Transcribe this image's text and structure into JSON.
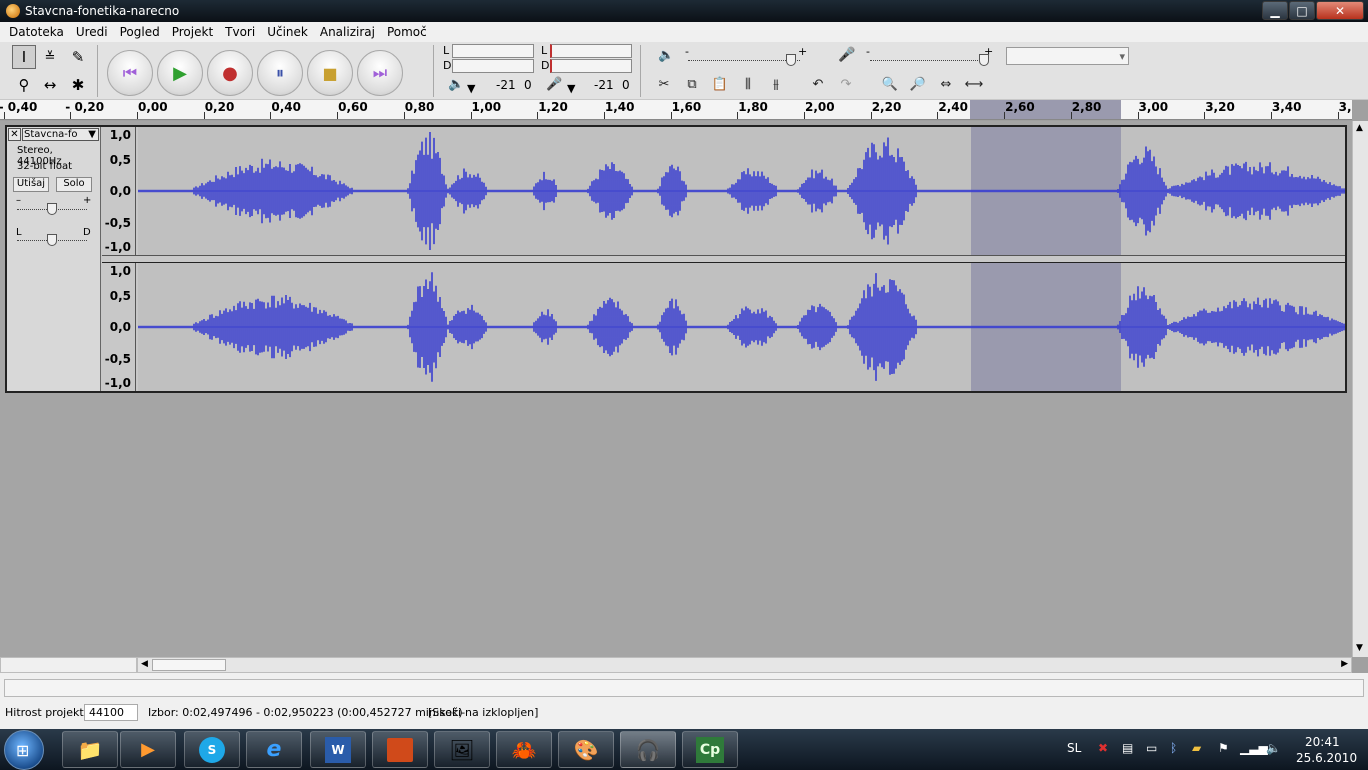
{
  "window": {
    "title": "Stavcna-fonetika-narecno",
    "minimize": "▁",
    "maximize": "□",
    "close": "✕"
  },
  "menu": [
    "Datoteka",
    "Uredi",
    "Pogled",
    "Projekt",
    "Tvori",
    "Učinek",
    "Analiziraj",
    "Pomoč"
  ],
  "tools": {
    "select": "I",
    "envelope": "≚",
    "draw": "✎",
    "zoom": "⚲",
    "timeshift": "↔",
    "multi": "✱"
  },
  "transport": {
    "skip_start": "⏮",
    "play": "▶",
    "record": "●",
    "pause": "⏸",
    "stop": "■",
    "skip_end": "⏭"
  },
  "meters": {
    "playback_left": "L",
    "playback_right": "D",
    "record_left": "L",
    "record_right": "D",
    "playback_db": "-21",
    "playback_zero": "0",
    "record_db": "-21",
    "record_zero": "0"
  },
  "mixer": {
    "speaker_icon": "speaker-icon",
    "mic_icon": "microphone-icon",
    "minus": "-",
    "plus": "+",
    "device_select": ""
  },
  "ruler": {
    "labels": [
      "- 0,40",
      "- 0,20",
      "0,00",
      "0,20",
      "0,40",
      "0,60",
      "0,80",
      "1,00",
      "1,20",
      "1,40",
      "1,60",
      "1,80",
      "2,00",
      "2,20",
      "2,40",
      "2,60",
      "2,80",
      "3,00",
      "3,20",
      "3,40",
      "3,60"
    ],
    "selection": [
      2.4975,
      2.9502
    ]
  },
  "track": {
    "name": "Stavcna-fo",
    "close": "✕",
    "menu_arrow": "▼",
    "format": "Stereo, 44100Hz",
    "bitdepth": "32-bit float",
    "mute": "Utišaj",
    "solo": "Solo",
    "gain_minus": "–",
    "gain_plus": "+",
    "pan_left": "L",
    "pan_right": "D",
    "scale": [
      "1,0",
      "0,5",
      "0,0",
      "-0,5",
      "-1,0"
    ],
    "wave_color": "#3a3fd0"
  },
  "status": {
    "rate_label": "Hitrost projekta:",
    "rate_value": "44100",
    "selection": "Izbor: 0:02,497496 - 0:02,950223 (0:00,452727 min:sek)",
    "snap": "[Skoči-na izklopljen]"
  },
  "taskbar": {
    "language": "SL",
    "time": "20:41",
    "date": "25.6.2010",
    "apps": [
      "windows-explorer",
      "media-player",
      "skype",
      "internet-explorer",
      "word",
      "powerpoint",
      "image-viewer",
      "crab-app",
      "paint",
      "audacity",
      "captivate"
    ],
    "captivate_label": "Cp",
    "word_label": "W"
  }
}
